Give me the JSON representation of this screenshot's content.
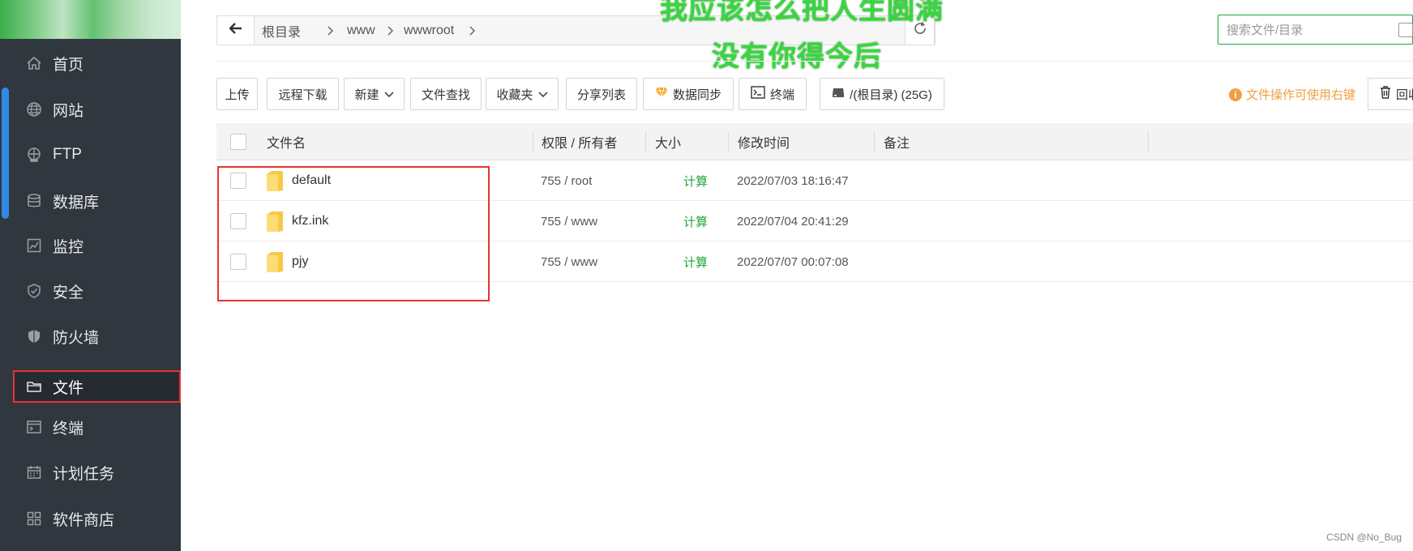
{
  "sidebar": {
    "items": [
      {
        "label": "首页",
        "icon": "home-icon"
      },
      {
        "label": "网站",
        "icon": "globe-icon"
      },
      {
        "label": "FTP",
        "icon": "ftp-icon"
      },
      {
        "label": "数据库",
        "icon": "database-icon"
      },
      {
        "label": "监控",
        "icon": "monitor-icon"
      },
      {
        "label": "安全",
        "icon": "shield-check-icon"
      },
      {
        "label": "防火墙",
        "icon": "firewall-icon"
      },
      {
        "label": "文件",
        "icon": "folder-icon",
        "active": true
      },
      {
        "label": "终端",
        "icon": "terminal-icon"
      },
      {
        "label": "计划任务",
        "icon": "calendar-icon"
      },
      {
        "label": "软件商店",
        "icon": "apps-icon"
      }
    ]
  },
  "breadcrumb": [
    "根目录",
    "www",
    "wwwroot"
  ],
  "search": {
    "placeholder": "搜索文件/目录"
  },
  "overlay_text": {
    "line1": "我应该怎么把人生圆满",
    "line2": "没有你得今后"
  },
  "toolbar": {
    "upload": "上传",
    "remote_download": "远程下载",
    "new": "新建",
    "file_search": "文件查找",
    "favorites": "收藏夹",
    "share_list": "分享列表",
    "data_sync": "数据同步",
    "terminal": "终端",
    "disk": "/(根目录) (25G)",
    "tip": "文件操作可使用右键",
    "recycle": "回收站"
  },
  "table": {
    "headers": {
      "name": "文件名",
      "perm": "权限 / 所有者",
      "size": "大小",
      "mtime": "修改时间",
      "note": "备注"
    },
    "rows": [
      {
        "name": "default",
        "perm": "755 / root",
        "size": "计算",
        "mtime": "2022/07/03 18:16:47"
      },
      {
        "name": "kfz.ink",
        "perm": "755 / www",
        "size": "计算",
        "mtime": "2022/07/04 20:41:29"
      },
      {
        "name": "pjy",
        "perm": "755 / www",
        "size": "计算",
        "mtime": "2022/07/07 00:07:08"
      }
    ]
  },
  "watermark": "CSDN @No_Bug",
  "colors": {
    "sidebar_bg": "#31373f",
    "brand_green": "#20a53a",
    "highlight_red": "#e8322e",
    "tip_orange": "#f0a040"
  }
}
